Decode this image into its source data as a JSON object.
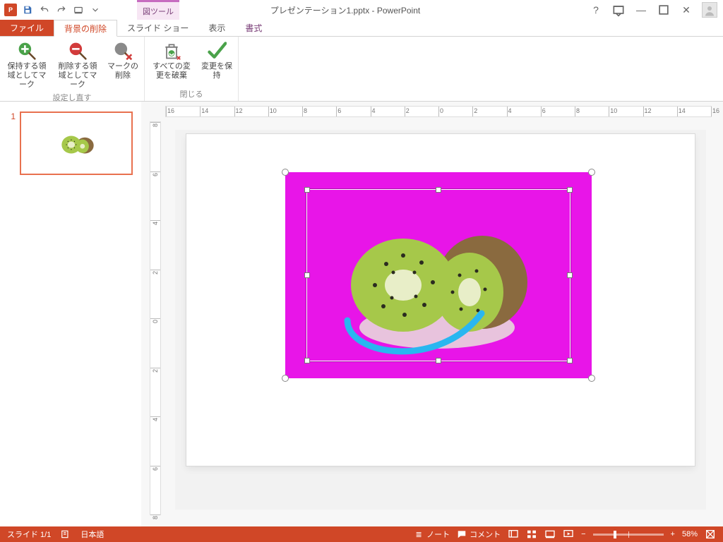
{
  "window": {
    "title": "プレゼンテーション1.pptx - PowerPoint",
    "contextual_tab_group": "図ツール"
  },
  "tabs": {
    "file": "ファイル",
    "bgremove": "背景の削除",
    "slideshow": "スライド ショー",
    "view": "表示",
    "format": "書式"
  },
  "ribbon": {
    "group_refine": "設定し直す",
    "group_close": "閉じる",
    "mark_keep": "保持する領域としてマーク",
    "mark_remove": "削除する領域としてマーク",
    "delete_mark": "マークの削除",
    "discard_all": "すべての変更を破棄",
    "keep_changes": "変更を保持"
  },
  "thumbs": {
    "slide1_num": "1"
  },
  "ruler": {
    "h_labels": [
      "16",
      "14",
      "12",
      "10",
      "8",
      "6",
      "4",
      "2",
      "0",
      "2",
      "4",
      "6",
      "8",
      "10",
      "12",
      "14",
      "16"
    ],
    "v_labels": [
      "8",
      "6",
      "4",
      "2",
      "0",
      "2",
      "4",
      "6",
      "8"
    ]
  },
  "status": {
    "slide_counter": "スライド 1/1",
    "language": "日本語",
    "notes": "ノート",
    "comments": "コメント",
    "zoom_percent": "58%",
    "zoom_value": 58
  },
  "colors": {
    "accent": "#d04727",
    "removal_bg": "#e815e8",
    "stroke": "#29b6f0"
  }
}
